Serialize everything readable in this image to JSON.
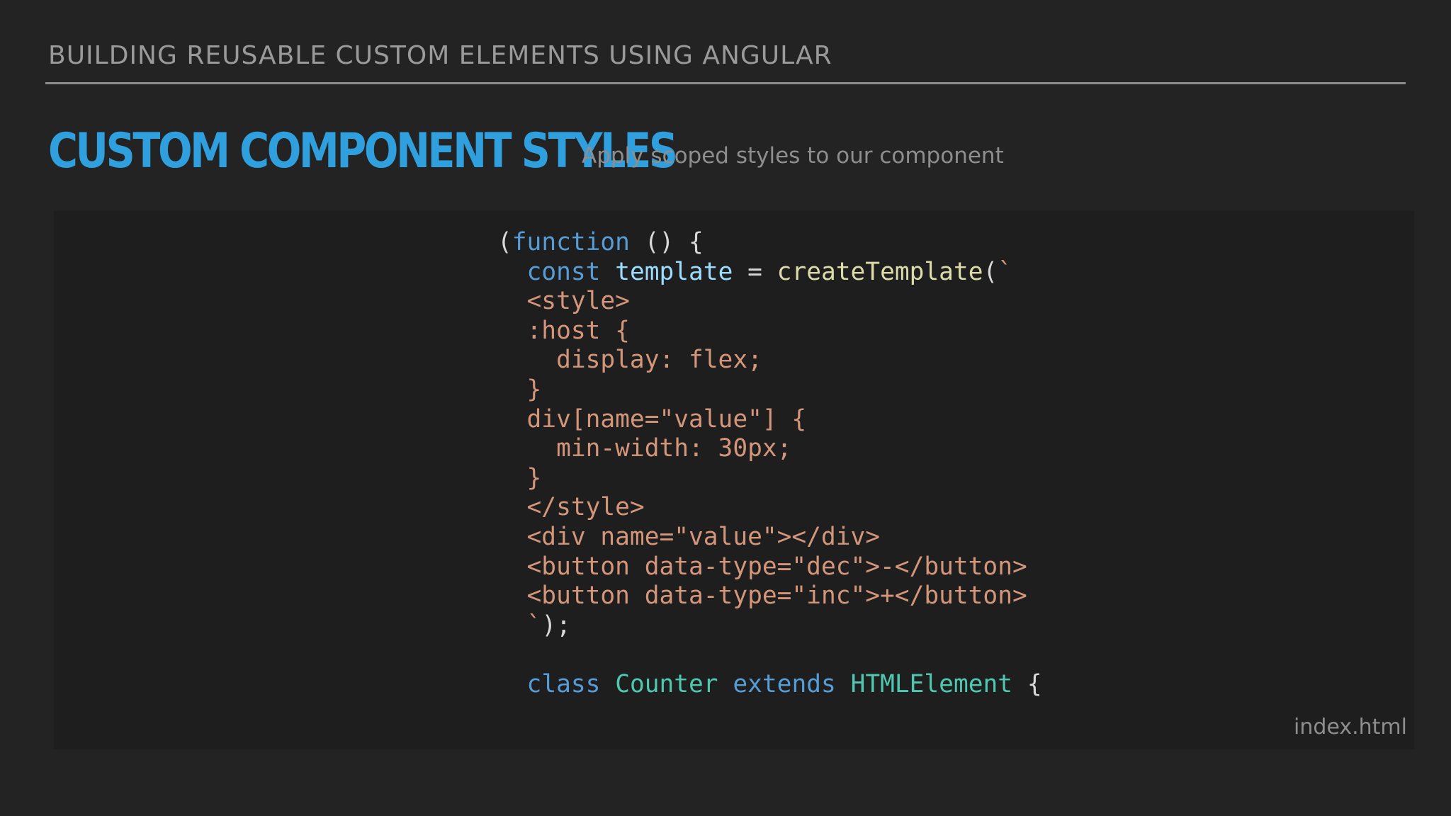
{
  "header": {
    "section_title": "BUILDING REUSABLE CUSTOM ELEMENTS USING ANGULAR"
  },
  "slide": {
    "title": "CUSTOM COMPONENT STYLES",
    "subtitle": "Apply scoped styles to our component"
  },
  "code": {
    "filename": "index.html",
    "lines": [
      [
        {
          "t": "(",
          "k": "p"
        },
        {
          "t": "function",
          "k": "kw"
        },
        {
          "t": " () {",
          "k": "p"
        }
      ],
      [
        {
          "t": "  ",
          "k": "p"
        },
        {
          "t": "const",
          "k": "kw"
        },
        {
          "t": " ",
          "k": "p"
        },
        {
          "t": "template",
          "k": "var"
        },
        {
          "t": " = ",
          "k": "p"
        },
        {
          "t": "createTemplate",
          "k": "fn"
        },
        {
          "t": "(",
          "k": "p"
        },
        {
          "t": "`",
          "k": "str"
        }
      ],
      [
        {
          "t": "  <style>",
          "k": "str"
        }
      ],
      [
        {
          "t": "  :host {",
          "k": "str"
        }
      ],
      [
        {
          "t": "    display: flex;",
          "k": "str"
        }
      ],
      [
        {
          "t": "  }",
          "k": "str"
        }
      ],
      [
        {
          "t": "  div[name=\"value\"] {",
          "k": "str"
        }
      ],
      [
        {
          "t": "    min-width: 30px;",
          "k": "str"
        }
      ],
      [
        {
          "t": "  }",
          "k": "str"
        }
      ],
      [
        {
          "t": "  </style>",
          "k": "str"
        }
      ],
      [
        {
          "t": "  <div name=\"value\"></div>",
          "k": "str"
        }
      ],
      [
        {
          "t": "  <button data-type=\"dec\">-</button>",
          "k": "str"
        }
      ],
      [
        {
          "t": "  <button data-type=\"inc\">+</button>",
          "k": "str"
        }
      ],
      [
        {
          "t": "  `",
          "k": "str"
        },
        {
          "t": ");",
          "k": "p"
        }
      ],
      [
        {
          "t": "",
          "k": "p"
        }
      ],
      [
        {
          "t": "  ",
          "k": "p"
        },
        {
          "t": "class",
          "k": "kw"
        },
        {
          "t": " ",
          "k": "p"
        },
        {
          "t": "Counter",
          "k": "cls"
        },
        {
          "t": " ",
          "k": "p"
        },
        {
          "t": "extends",
          "k": "kw"
        },
        {
          "t": " ",
          "k": "p"
        },
        {
          "t": "HTMLElement",
          "k": "cls"
        },
        {
          "t": " {",
          "k": "p"
        }
      ]
    ]
  },
  "colors": {
    "background": "#232323",
    "code_background": "#1e1e1e",
    "title_accent": "#2f9fde",
    "keyword": "#569cd6",
    "variable": "#9cdcfe",
    "function": "#dcdcaa",
    "string": "#d4967a",
    "class_name": "#4ec9b0"
  }
}
